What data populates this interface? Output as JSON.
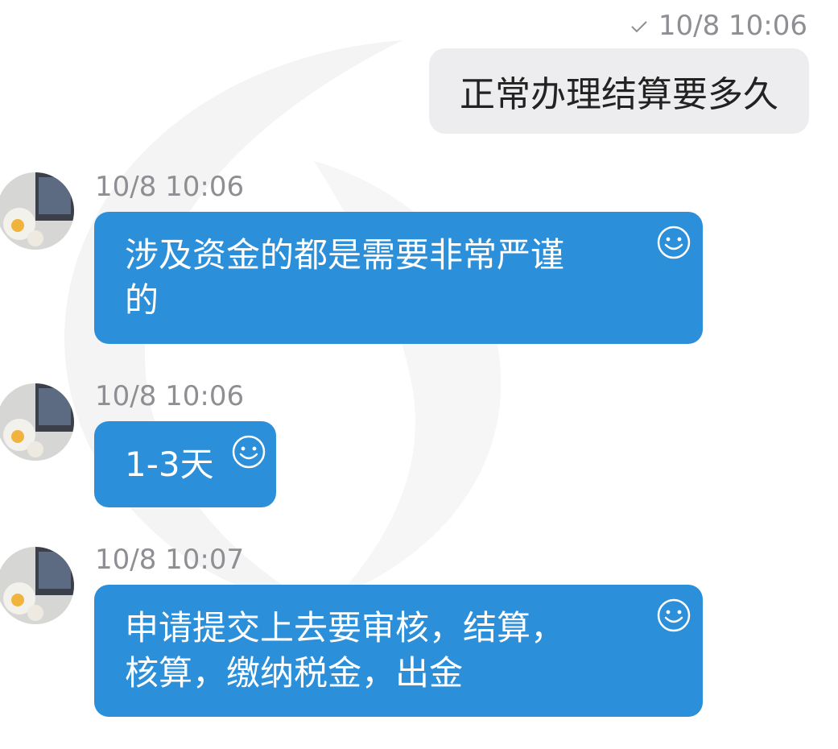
{
  "messages": {
    "outgoing": {
      "time": "10/8 10:06",
      "text": "正常办理结算要多久",
      "status_icon": "check-icon"
    },
    "incoming": [
      {
        "time": "10/8 10:06",
        "line1": "涉及资金的都是需要非常严谨",
        "line2": "的",
        "icon": "smile-icon"
      },
      {
        "time": "10/8 10:06",
        "line1": "1-3天",
        "icon": "smile-icon"
      },
      {
        "time": "10/8 10:07",
        "line1": "申请提交上去要审核，结算，",
        "line2": "核算，缴纳税金，出金",
        "icon": "smile-icon"
      }
    ]
  },
  "colors": {
    "incoming_bubble": "#2c8fd9",
    "outgoing_bubble": "#ededf0",
    "timestamp": "#8e8e93"
  }
}
